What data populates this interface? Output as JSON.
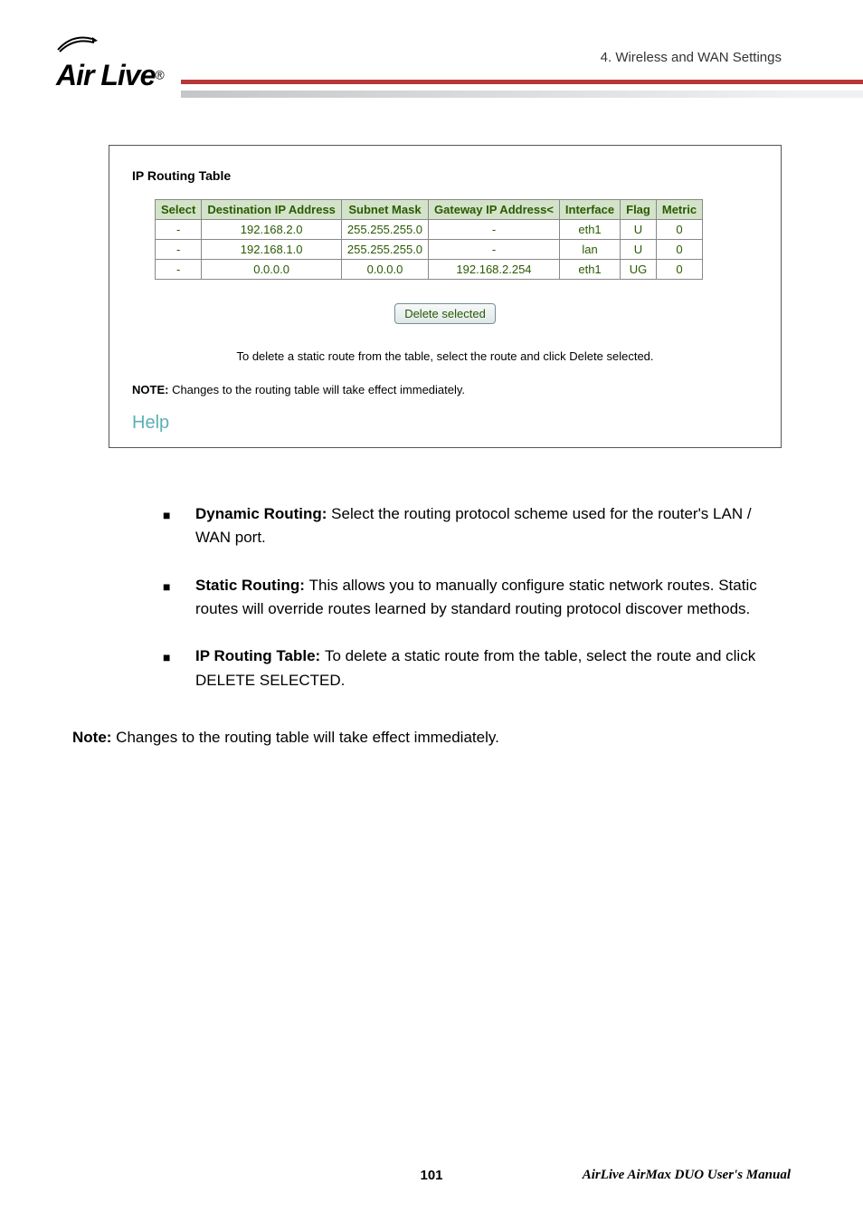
{
  "header": {
    "breadcrumb": "4. Wireless and WAN Settings",
    "logo_text": "Air Live",
    "logo_reg": "®"
  },
  "panel": {
    "title": "IP Routing Table",
    "columns": {
      "select": "Select",
      "dest": "Destination IP Address",
      "mask": "Subnet Mask",
      "gateway": "Gateway IP Address<",
      "iface": "Interface",
      "flag": "Flag",
      "metric": "Metric"
    },
    "rows": [
      {
        "select": "-",
        "dest": "192.168.2.0",
        "mask": "255.255.255.0",
        "gateway": "-",
        "iface": "eth1",
        "flag": "U",
        "metric": "0"
      },
      {
        "select": "-",
        "dest": "192.168.1.0",
        "mask": "255.255.255.0",
        "gateway": "-",
        "iface": "lan",
        "flag": "U",
        "metric": "0"
      },
      {
        "select": "-",
        "dest": "0.0.0.0",
        "mask": "0.0.0.0",
        "gateway": "192.168.2.254",
        "iface": "eth1",
        "flag": "UG",
        "metric": "0"
      }
    ],
    "delete_button": "Delete selected",
    "delete_hint": "To delete a static route from the table, select the route and click Delete selected.",
    "note_label": "NOTE:",
    "note_text": " Changes to the routing table will take effect immediately.",
    "help": "Help"
  },
  "content": {
    "items": [
      {
        "bold": "Dynamic Routing: ",
        "text": "Select the routing protocol scheme used for the router's LAN / WAN port."
      },
      {
        "bold": "Static Routing: ",
        "text": "This allows you to manually configure static network routes. Static routes will override routes learned by standard routing protocol discover methods."
      },
      {
        "bold": "IP Routing Table: ",
        "text": "To delete a static route from the table, select the route and click DELETE SELECTED."
      }
    ],
    "note_label": "Note:",
    "note_text": " Changes to the routing table will take effect immediately."
  },
  "footer": {
    "page": "101",
    "title": "AirLive AirMax DUO User's Manual"
  }
}
